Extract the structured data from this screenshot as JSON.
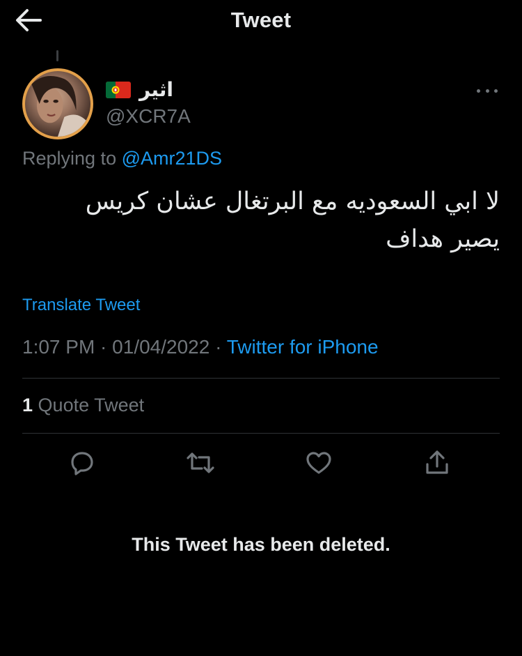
{
  "header": {
    "title": "Tweet",
    "back_icon": "arrow-left-icon"
  },
  "author": {
    "display_name": "اثير",
    "flag": "Portugal",
    "handle": "@XCR7A",
    "avatar_border_color": "#e3a04a"
  },
  "replying": {
    "prefix": "Replying to",
    "mention": "@Amr21DS"
  },
  "tweet": {
    "text_line1": "لا ابي السعوديه مع البرتغال عشان كريس",
    "text_line2": "يصير هداف"
  },
  "translate_label": "Translate Tweet",
  "meta": {
    "time": "1:07 PM",
    "sep1": " · ",
    "date": "01/04/2022",
    "sep2": " · ",
    "source": "Twitter for iPhone"
  },
  "stats": {
    "quote_count": "1",
    "quote_label": "Quote Tweet"
  },
  "actions": [
    "reply-icon",
    "retweet-icon",
    "like-icon",
    "share-icon"
  ],
  "deleted_notice": "This Tweet has been deleted.",
  "colors": {
    "background": "#000000",
    "text": "#e7e9ea",
    "muted": "#71767b",
    "link": "#1d9bf0",
    "divider": "#2f3336"
  }
}
